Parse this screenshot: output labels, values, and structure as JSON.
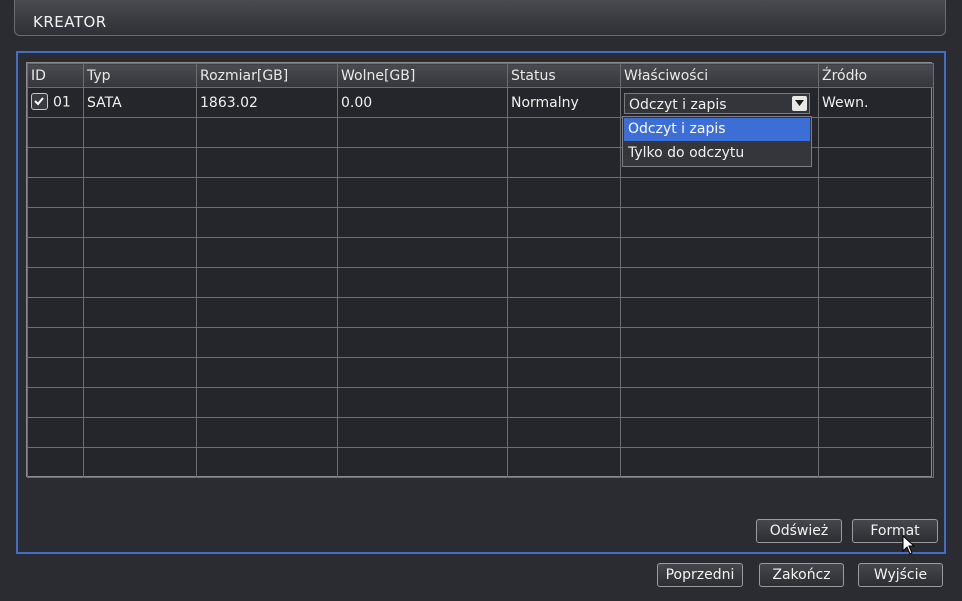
{
  "window": {
    "title": "KREATOR"
  },
  "table": {
    "headers": [
      "ID",
      "Typ",
      "Rozmiar[GB]",
      "Wolne[GB]",
      "Status",
      "Właściwości",
      "Źródło"
    ],
    "row": {
      "id": "01",
      "type": "SATA",
      "size": "1863.02",
      "free": "0.00",
      "status": "Normalny",
      "property": "Odczyt i zapis",
      "source": "Wewn."
    }
  },
  "dropdown": {
    "options": [
      "Odczyt i zapis",
      "Tylko do odczytu"
    ]
  },
  "buttons": {
    "refresh": "Odśwież",
    "format": "Format",
    "previous": "Poprzedni",
    "finish": "Zakończ",
    "exit": "Wyjście"
  },
  "colors": {
    "accent": "#3f6fc9",
    "selection": "#3d6ed6"
  }
}
